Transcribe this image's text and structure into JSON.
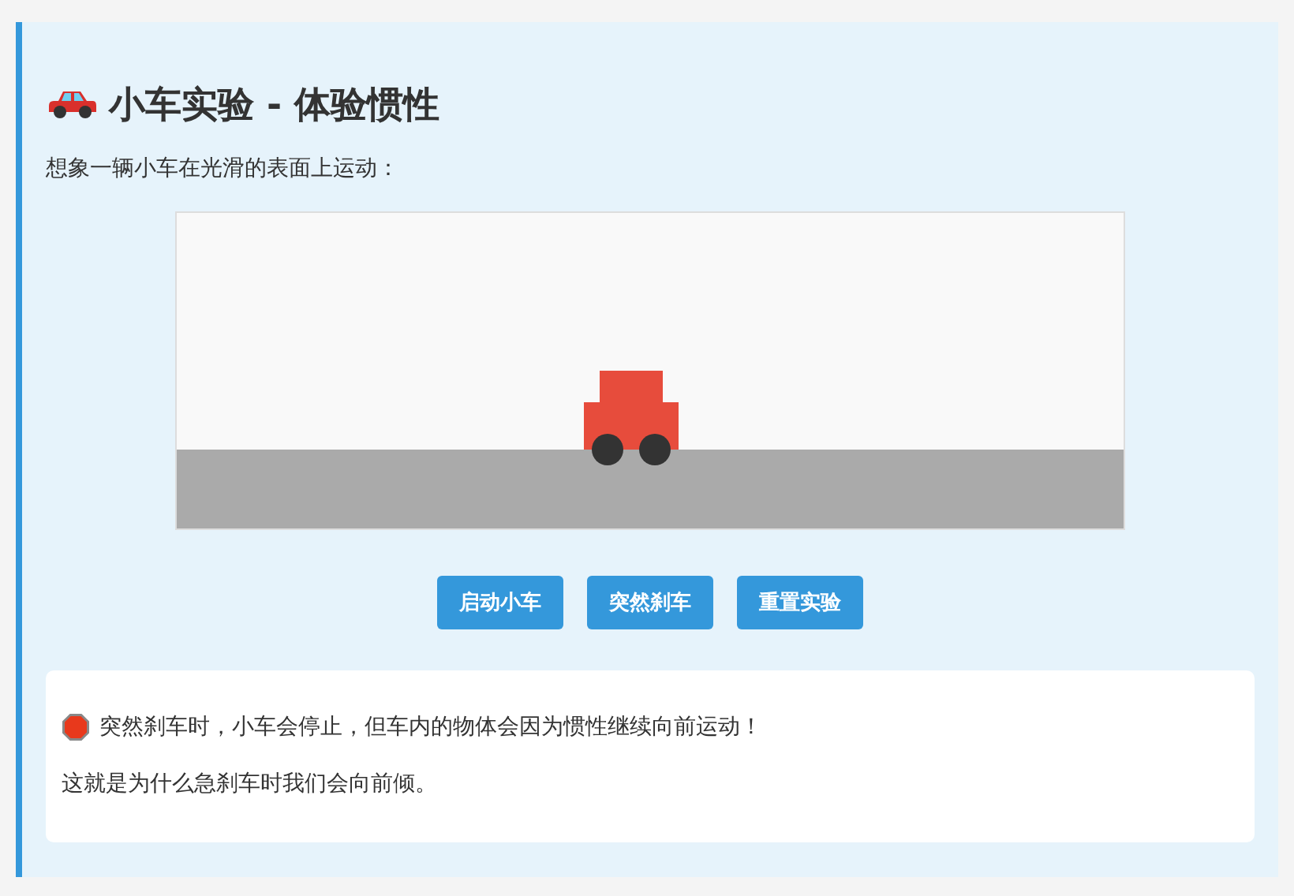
{
  "title": "小车实验 - 体验惯性",
  "intro": "想象一辆小车在光滑的表面上运动：",
  "buttons": [
    {
      "label": "启动小车"
    },
    {
      "label": "突然刹车"
    },
    {
      "label": "重置实验"
    }
  ],
  "note": {
    "lines": [
      "突然刹车时，小车会停止，但车内的物体会因为惯性继续向前运动！",
      "这就是为什么急刹车时我们会向前倾。"
    ]
  }
}
